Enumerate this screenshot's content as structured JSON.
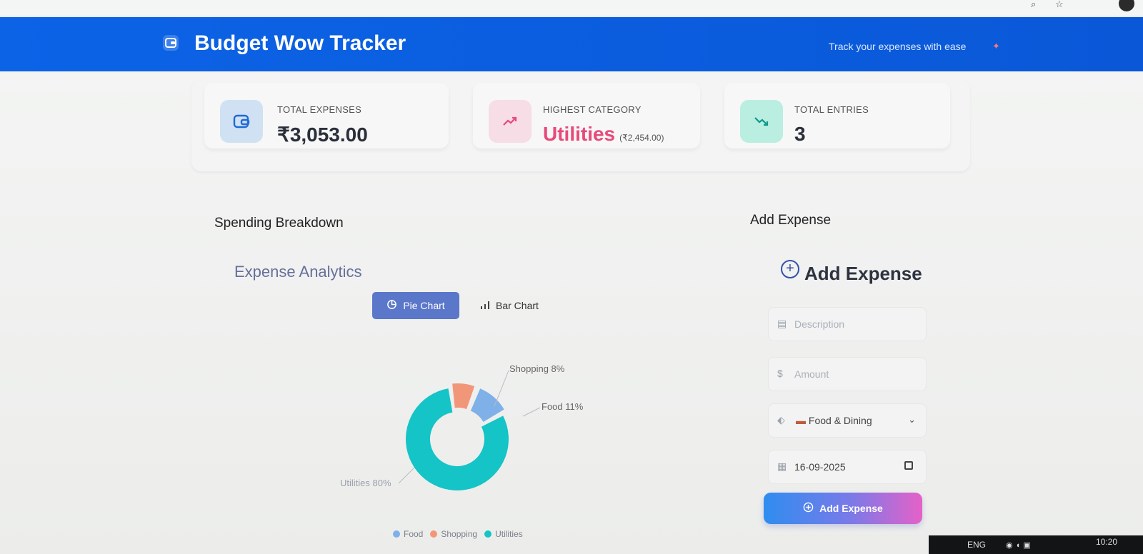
{
  "header": {
    "title": "Budget Wow Tracker",
    "tagline": "Track your expenses with ease"
  },
  "stats": {
    "total_expenses": {
      "label": "TOTAL EXPENSES",
      "value": "₹3,053.00"
    },
    "highest_category": {
      "label": "HIGHEST CATEGORY",
      "value": "Utilities",
      "sub": "(₹2,454.00)"
    },
    "total_entries": {
      "label": "TOTAL ENTRIES",
      "value": "3"
    }
  },
  "spending": {
    "section_title": "Spending Breakdown",
    "analytics_title": "Expense Analytics",
    "tabs": {
      "pie": "Pie Chart",
      "bar": "Bar Chart"
    },
    "slice_labels": {
      "shopping": "Shopping 8%",
      "food": "Food 11%",
      "utilities": "Utilities 80%"
    },
    "legend": {
      "food": "Food",
      "shopping": "Shopping",
      "utilities": "Utilities"
    }
  },
  "chart_data": {
    "type": "pie",
    "categories": [
      "Utilities",
      "Shopping",
      "Food"
    ],
    "values": [
      80,
      8,
      11
    ],
    "colors": [
      "#14c4c6",
      "#f2967a",
      "#7fb0e8"
    ]
  },
  "form": {
    "section_title": "Add Expense",
    "title": "Add Expense",
    "description_placeholder": "Description",
    "amount_placeholder": "Amount",
    "category_value": "Food & Dining",
    "date_value": "16-09-2025",
    "submit_label": "Add Expense"
  },
  "taskbar": {
    "language": "ENG",
    "time": "10:20"
  },
  "colors": {
    "header_blue": "#0c63e6",
    "accent_pink": "#e8497a",
    "tab_active": "#5b77c9"
  }
}
